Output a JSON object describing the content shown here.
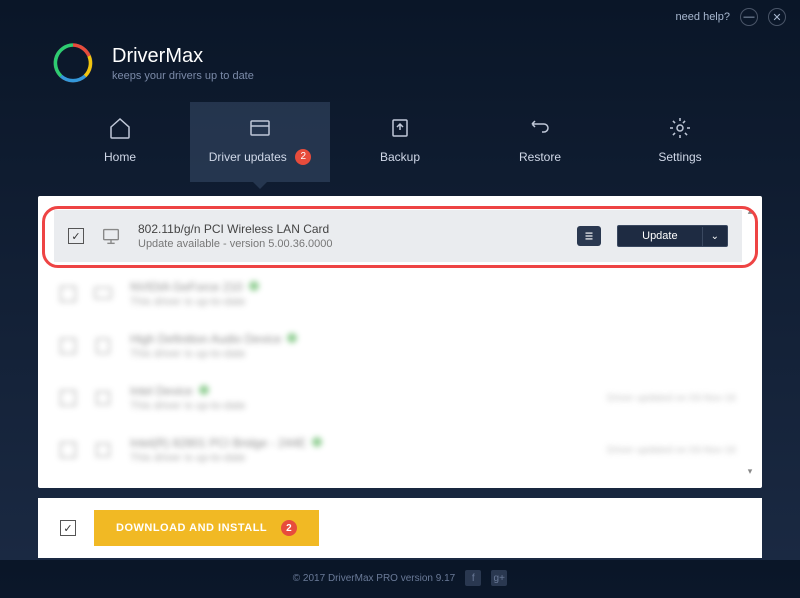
{
  "title_bar": {
    "help_label": "need help?"
  },
  "brand": {
    "name": "DriverMax",
    "tagline": "keeps your drivers up to date"
  },
  "nav": {
    "items": [
      {
        "label": "Home"
      },
      {
        "label": "Driver updates",
        "badge": "2"
      },
      {
        "label": "Backup"
      },
      {
        "label": "Restore"
      },
      {
        "label": "Settings"
      }
    ]
  },
  "drivers": [
    {
      "name": "802.11b/g/n PCI Wireless LAN Card",
      "status": "Update available - version 5.00.36.0000",
      "checked": true,
      "update_label": "Update"
    },
    {
      "name": "NVIDIA GeForce 210",
      "status": "This driver is up-to-date"
    },
    {
      "name": "High Definition Audio Device",
      "status": "This driver is up-to-date"
    },
    {
      "name": "Intel Device",
      "status": "This driver is up-to-date",
      "right": "Driver updated on 03-Nov-16"
    },
    {
      "name": "Intel(R) 82801 PCI Bridge - 244E",
      "status": "This driver is up-to-date",
      "right": "Driver updated on 03-Nov-16"
    }
  ],
  "action": {
    "download_label": "DOWNLOAD AND INSTALL",
    "badge": "2"
  },
  "footer": {
    "copyright": "© 2017 DriverMax PRO version 9.17"
  }
}
